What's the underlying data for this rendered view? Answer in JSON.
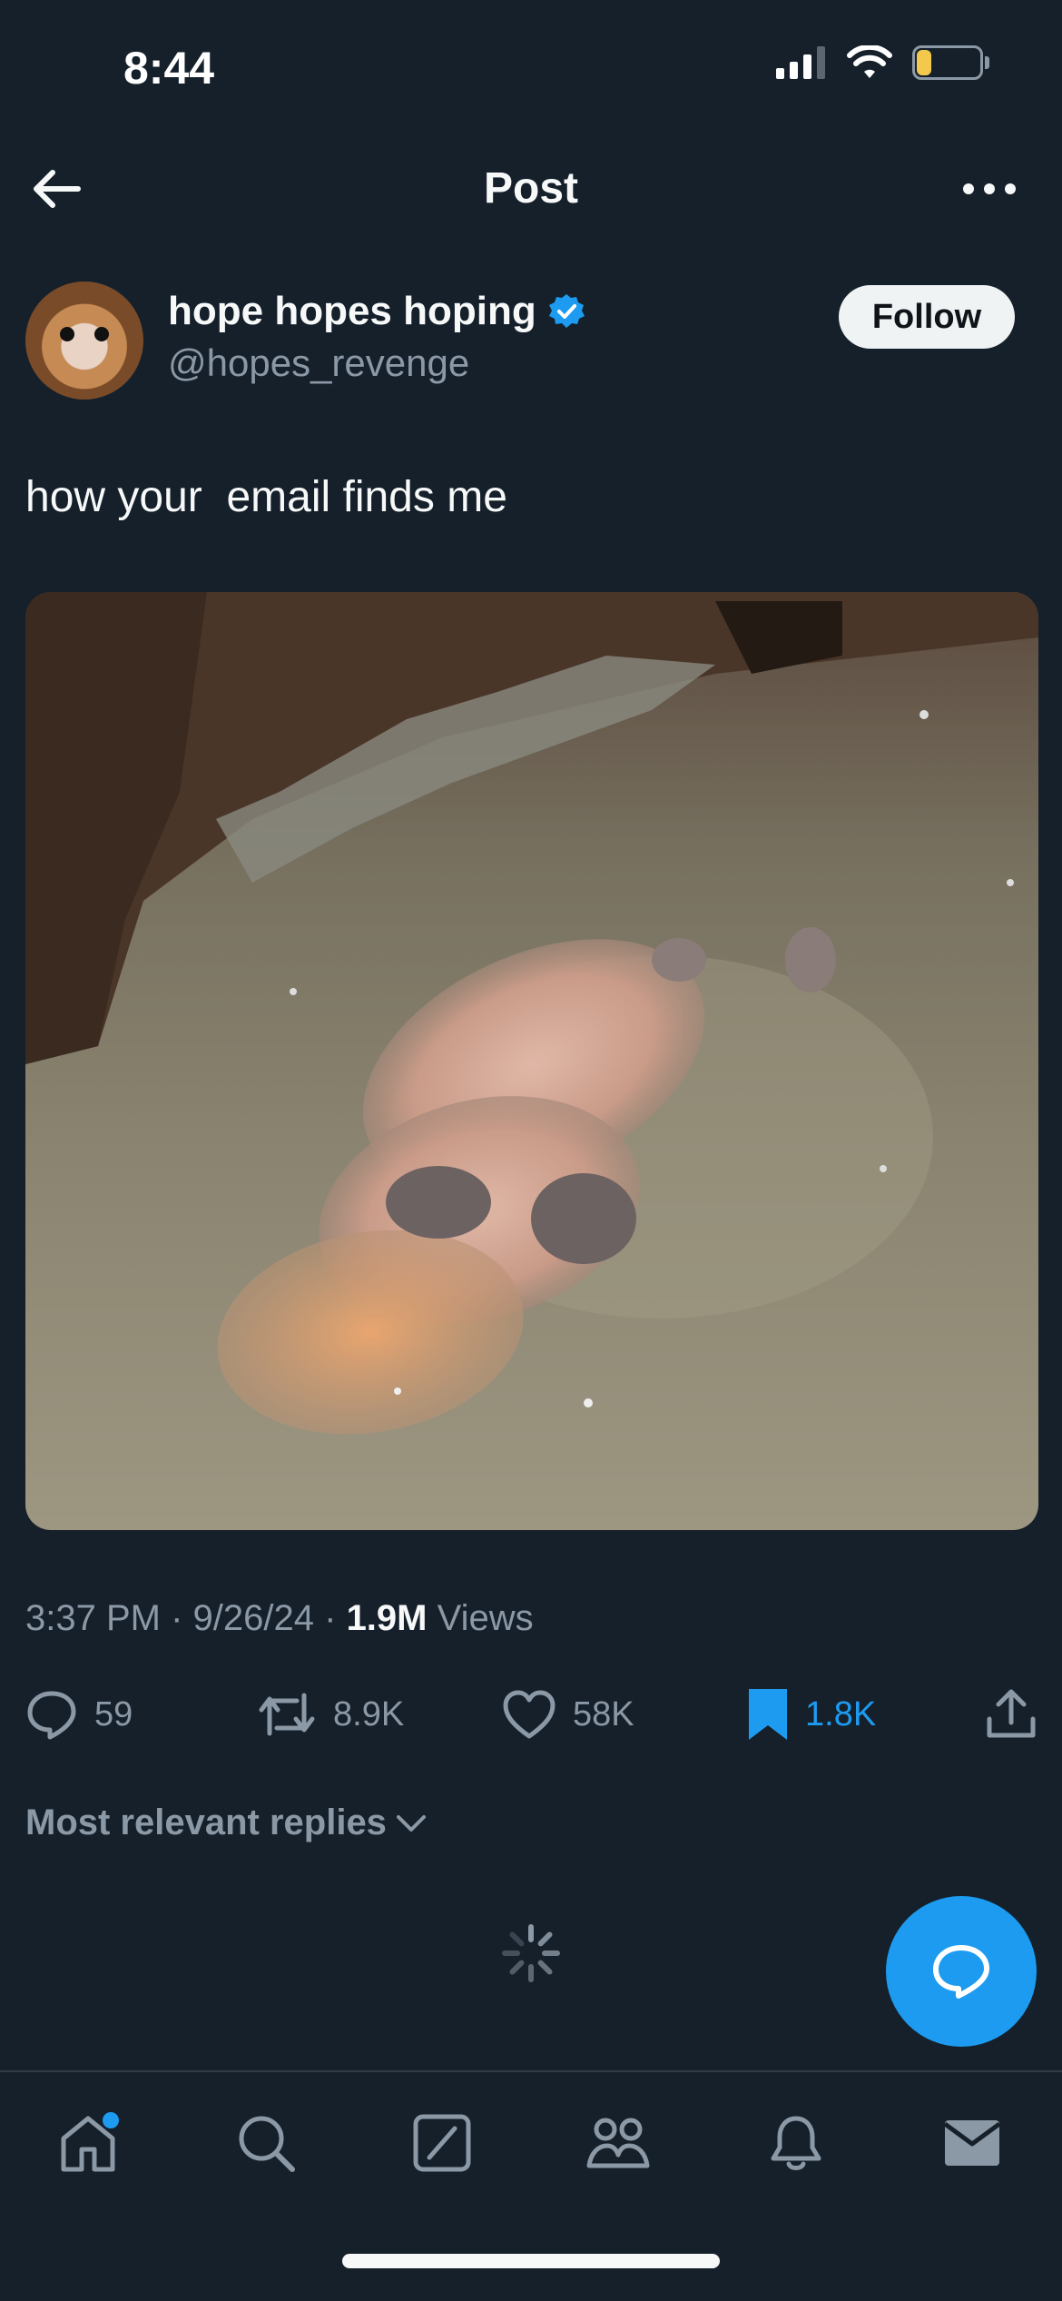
{
  "status_bar": {
    "time": "8:44",
    "battery": "17"
  },
  "header": {
    "title": "Post"
  },
  "author": {
    "name": "hope hopes hoping",
    "handle": "@hopes_revenge",
    "follow_label": "Follow"
  },
  "tweet": {
    "text": "how your  email finds me"
  },
  "media": {
    "alt": "video still of a baby hippo floating on its back in murky water"
  },
  "meta": {
    "time": "3:37 PM",
    "date": "9/26/24",
    "views_count": "1.9M",
    "views_label": "Views"
  },
  "actions": {
    "replies": "59",
    "reposts": "8.9K",
    "likes": "58K",
    "bookmarks": "1.8K"
  },
  "replies_filter": {
    "label": "Most relevant replies"
  },
  "colors": {
    "background": "#15202b",
    "accent": "#1d9bf0",
    "muted": "#8b98a5"
  }
}
